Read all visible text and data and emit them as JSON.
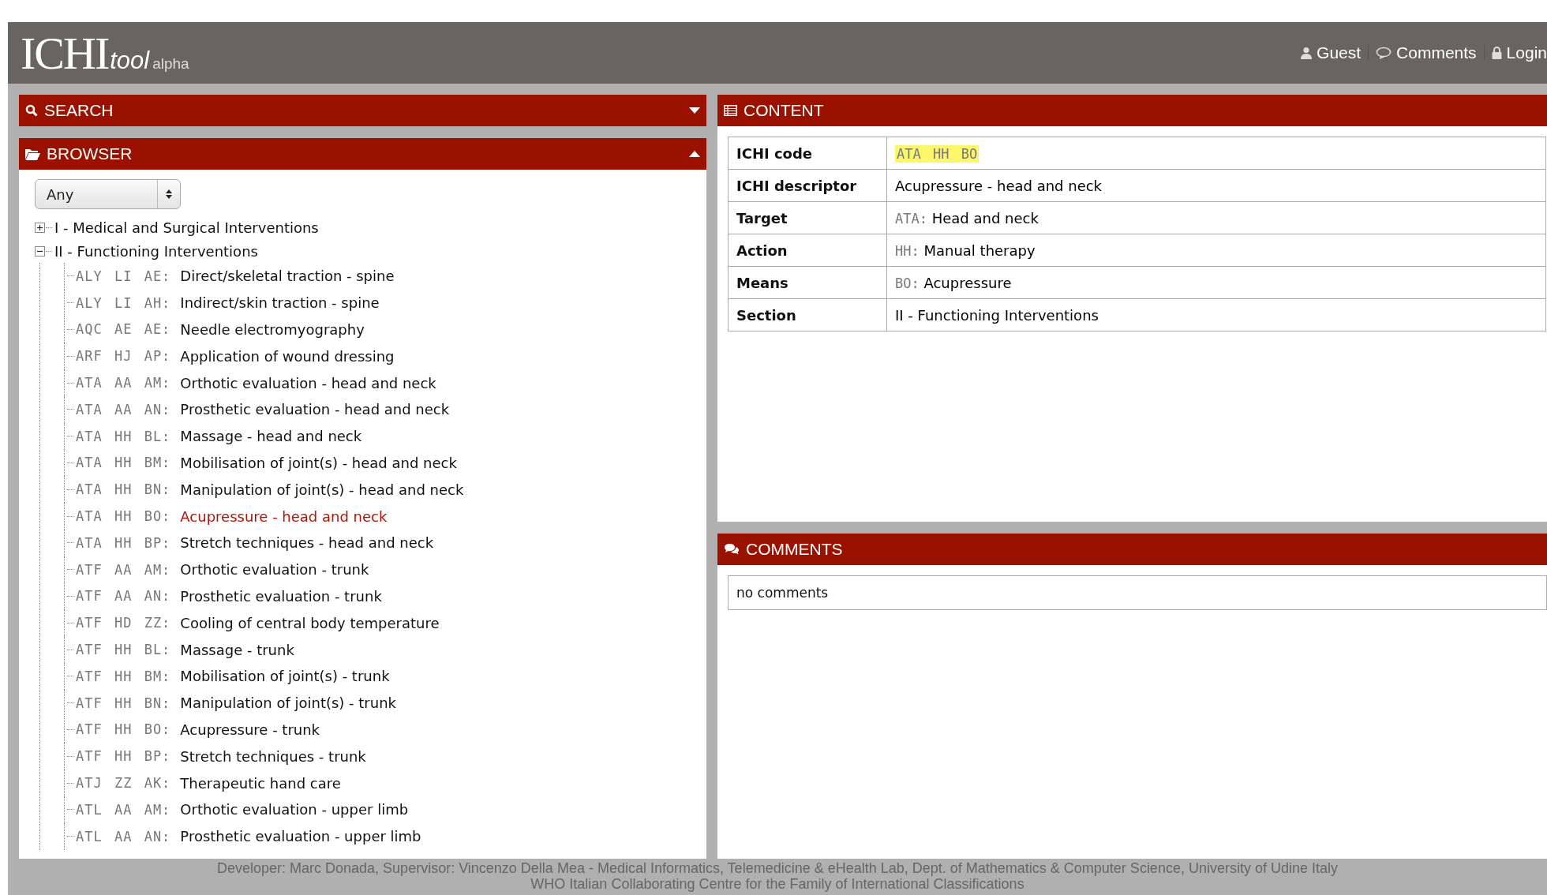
{
  "header": {
    "logo": "ICHI",
    "logo_sub": "tool",
    "badge": "alpha",
    "links": [
      {
        "kind": "user",
        "label": "Guest"
      },
      {
        "kind": "comment",
        "label": "Comments"
      },
      {
        "kind": "lock",
        "label": "Login"
      }
    ]
  },
  "search": {
    "title": "SEARCH",
    "expanded": false
  },
  "browser": {
    "title": "BROWSER",
    "expanded": true,
    "filter": {
      "value": "Any"
    },
    "tree": [
      {
        "label": "I - Medical and Surgical Interventions",
        "expanded": false
      },
      {
        "label": "II - Functioning Interventions",
        "expanded": true,
        "children": [
          {
            "code": "ALY LI AE:",
            "label": "Direct/skeletal traction - spine",
            "selected": false
          },
          {
            "code": "ALY LI AH:",
            "label": "Indirect/skin traction - spine",
            "selected": false
          },
          {
            "code": "AQC AE AE:",
            "label": "Needle electromyography",
            "selected": false
          },
          {
            "code": "ARF HJ AP:",
            "label": "Application of wound dressing",
            "selected": false
          },
          {
            "code": "ATA AA AM:",
            "label": "Orthotic evaluation - head and neck",
            "selected": false
          },
          {
            "code": "ATA AA AN:",
            "label": "Prosthetic evaluation - head and neck",
            "selected": false
          },
          {
            "code": "ATA HH BL:",
            "label": "Massage - head and neck",
            "selected": false
          },
          {
            "code": "ATA HH BM:",
            "label": "Mobilisation of joint(s) - head and neck",
            "selected": false
          },
          {
            "code": "ATA HH BN:",
            "label": "Manipulation of joint(s) - head and neck",
            "selected": false
          },
          {
            "code": "ATA HH BO:",
            "label": "Acupressure - head and neck",
            "selected": true
          },
          {
            "code": "ATA HH BP:",
            "label": "Stretch techniques - head and neck",
            "selected": false
          },
          {
            "code": "ATF AA AM:",
            "label": "Orthotic evaluation - trunk",
            "selected": false
          },
          {
            "code": "ATF AA AN:",
            "label": "Prosthetic evaluation - trunk",
            "selected": false
          },
          {
            "code": "ATF HD ZZ:",
            "label": "Cooling of central body temperature",
            "selected": false
          },
          {
            "code": "ATF HH BL:",
            "label": "Massage - trunk",
            "selected": false
          },
          {
            "code": "ATF HH BM:",
            "label": "Mobilisation of joint(s) - trunk",
            "selected": false
          },
          {
            "code": "ATF HH BN:",
            "label": "Manipulation of joint(s) - trunk",
            "selected": false
          },
          {
            "code": "ATF HH BO:",
            "label": "Acupressure - trunk",
            "selected": false
          },
          {
            "code": "ATF HH BP:",
            "label": "Stretch techniques - trunk",
            "selected": false
          },
          {
            "code": "ATJ ZZ AK:",
            "label": "Therapeutic hand care",
            "selected": false
          },
          {
            "code": "ATL AA AM:",
            "label": "Orthotic evaluation - upper limb",
            "selected": false
          },
          {
            "code": "ATL AA AN:",
            "label": "Prosthetic evaluation - upper limb",
            "selected": false
          }
        ]
      }
    ]
  },
  "content": {
    "title": "CONTENT",
    "rows": [
      {
        "kind": "highlight",
        "label": "ICHI code",
        "value": "ATA HH BO"
      },
      {
        "kind": "text",
        "label": "ICHI descriptor",
        "value": "Acupressure - head and neck"
      },
      {
        "kind": "coded",
        "label": "Target",
        "code": "ATA:",
        "value": "Head and neck"
      },
      {
        "kind": "coded",
        "label": "Action",
        "code": "HH:",
        "value": "Manual therapy"
      },
      {
        "kind": "coded",
        "label": "Means",
        "code": "BO:",
        "value": "Acupressure"
      },
      {
        "kind": "text",
        "label": "Section",
        "value": "II - Functioning Interventions"
      }
    ]
  },
  "comments": {
    "title": "COMMENTS",
    "empty_text": "no comments"
  },
  "footer": [
    "Developer: Marc Donada, Supervisor: Vincenzo Della Mea - Medical Informatics, Telemedicine & eHealth Lab, Dept. of Mathematics & Computer Science, University of Udine Italy",
    "WHO Italian Collaborating Centre for the Family of International Classifications"
  ]
}
